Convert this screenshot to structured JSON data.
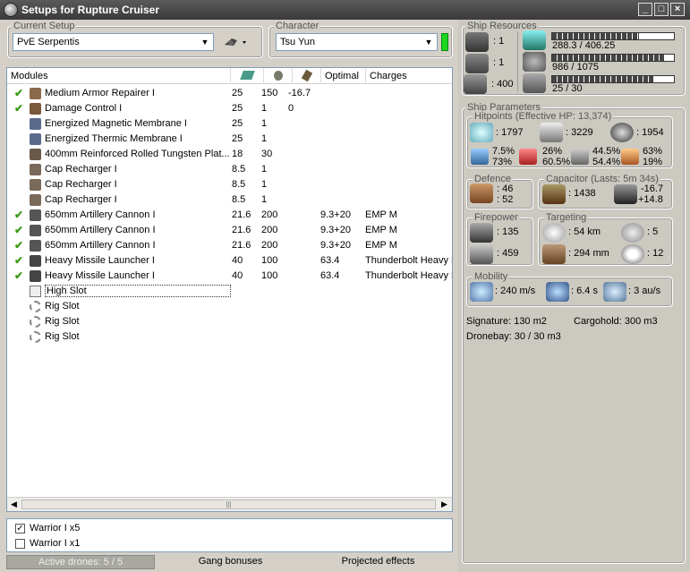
{
  "window": {
    "title": "Setups for Rupture Cruiser",
    "min": "_",
    "max": "□",
    "close": "×"
  },
  "setup": {
    "label": "Current Setup",
    "value": "PvE Serpentis"
  },
  "character": {
    "label": "Character",
    "value": "Tsu Yun"
  },
  "table": {
    "headers": [
      "Modules",
      "",
      "",
      "",
      "Optimal",
      "Charges"
    ],
    "rows": [
      {
        "check": true,
        "name": "Medium Armor Repairer I",
        "c1": "25",
        "c2": "150",
        "c3": "-16.7",
        "optimal": "",
        "charges": "",
        "icon": "#8a6a4a"
      },
      {
        "check": true,
        "name": "Damage Control I",
        "c1": "25",
        "c2": "1",
        "c3": "0",
        "optimal": "",
        "charges": "",
        "icon": "#7a5a3a"
      },
      {
        "check": false,
        "name": "Energized Magnetic Membrane I",
        "c1": "25",
        "c2": "1",
        "c3": "",
        "optimal": "",
        "charges": "",
        "icon": "#5a6a8a"
      },
      {
        "check": false,
        "name": "Energized Thermic Membrane I",
        "c1": "25",
        "c2": "1",
        "c3": "",
        "optimal": "",
        "charges": "",
        "icon": "#5a6a8a"
      },
      {
        "check": false,
        "name": "400mm Reinforced Rolled Tungsten Plat...",
        "c1": "18",
        "c2": "30",
        "c3": "",
        "optimal": "",
        "charges": "",
        "icon": "#6a5a4a"
      },
      {
        "check": false,
        "name": "Cap Recharger I",
        "c1": "8.5",
        "c2": "1",
        "c3": "",
        "optimal": "",
        "charges": "",
        "icon": "#7a6a5a"
      },
      {
        "check": false,
        "name": "Cap Recharger I",
        "c1": "8.5",
        "c2": "1",
        "c3": "",
        "optimal": "",
        "charges": "",
        "icon": "#7a6a5a"
      },
      {
        "check": false,
        "name": "Cap Recharger I",
        "c1": "8.5",
        "c2": "1",
        "c3": "",
        "optimal": "",
        "charges": "",
        "icon": "#7a6a5a"
      },
      {
        "check": true,
        "name": "650mm Artillery Cannon I",
        "c1": "21.6",
        "c2": "200",
        "c3": "",
        "optimal": "9.3+20",
        "charges": "EMP M",
        "icon": "#555"
      },
      {
        "check": true,
        "name": "650mm Artillery Cannon I",
        "c1": "21.6",
        "c2": "200",
        "c3": "",
        "optimal": "9.3+20",
        "charges": "EMP M",
        "icon": "#555"
      },
      {
        "check": true,
        "name": "650mm Artillery Cannon I",
        "c1": "21.6",
        "c2": "200",
        "c3": "",
        "optimal": "9.3+20",
        "charges": "EMP M",
        "icon": "#555"
      },
      {
        "check": true,
        "name": "Heavy Missile Launcher I",
        "c1": "40",
        "c2": "100",
        "c3": "",
        "optimal": "63.4",
        "charges": "Thunderbolt Heavy M",
        "icon": "#444"
      },
      {
        "check": true,
        "name": "Heavy Missile Launcher I",
        "c1": "40",
        "c2": "100",
        "c3": "",
        "optimal": "63.4",
        "charges": "Thunderbolt Heavy M",
        "icon": "#444"
      },
      {
        "check": false,
        "name": "High Slot",
        "c1": "",
        "c2": "",
        "c3": "",
        "optimal": "",
        "charges": "",
        "icon": "slot"
      },
      {
        "check": false,
        "name": "Rig Slot",
        "c1": "",
        "c2": "",
        "c3": "",
        "optimal": "",
        "charges": "",
        "icon": "ring"
      },
      {
        "check": false,
        "name": "Rig Slot",
        "c1": "",
        "c2": "",
        "c3": "",
        "optimal": "",
        "charges": "",
        "icon": "ring"
      },
      {
        "check": false,
        "name": "Rig Slot",
        "c1": "",
        "c2": "",
        "c3": "",
        "optimal": "",
        "charges": "",
        "icon": "ring"
      }
    ],
    "scroll_grip": "|||"
  },
  "drones": [
    {
      "checked": true,
      "label": "Warrior I x5"
    },
    {
      "checked": false,
      "label": "Warrior I x1"
    }
  ],
  "tabs": {
    "active_drones": "Active drones: 5 / 5",
    "gang": "Gang bonuses",
    "projected": "Projected effects"
  },
  "resources": {
    "label": "Ship Resources",
    "turret": ": 1",
    "launcher": ": 1",
    "drones": ": 400",
    "cpu": "288.3 / 406.25",
    "cpu_frac": 0.71,
    "power": "986 / 1075",
    "power_frac": 0.92,
    "calibration": "25 / 30",
    "calibration_frac": 0.83
  },
  "params": {
    "label": "Ship Parameters",
    "hitpoints": {
      "label": "Hitpoints (Effective HP: 13,374)",
      "shield": ": 1797",
      "armor": ": 3229",
      "structure": ": 1954",
      "res": [
        [
          "7.5%",
          "73%"
        ],
        [
          "26%",
          "60.5%"
        ],
        [
          "44.5%",
          "54.4%"
        ],
        [
          "63%",
          "19%"
        ]
      ]
    },
    "defence": {
      "label": "Defence",
      "a": ": 46",
      "b": ": 52"
    },
    "capacitor": {
      "label": "Capacitor (Lasts: 5m 34s)",
      "cap": ": 1438",
      "a": "-16.7",
      "b": "+14.8"
    },
    "firepower": {
      "label": "Firepower",
      "turret": ": 135",
      "missile": ": 459"
    },
    "targeting": {
      "label": "Targeting",
      "range": ": 54 km",
      "targets": ": 5",
      "res": ": 294 mm",
      "sensor": ": 12"
    },
    "mobility": {
      "label": "Mobility",
      "speed": ": 240 m/s",
      "align": ": 6.4 s",
      "warp": ": 3 au/s"
    },
    "signature": "Signature: 130 m2",
    "cargohold": "Cargohold: 300 m3",
    "dronebay": "Dronebay: 30 / 30 m3"
  }
}
